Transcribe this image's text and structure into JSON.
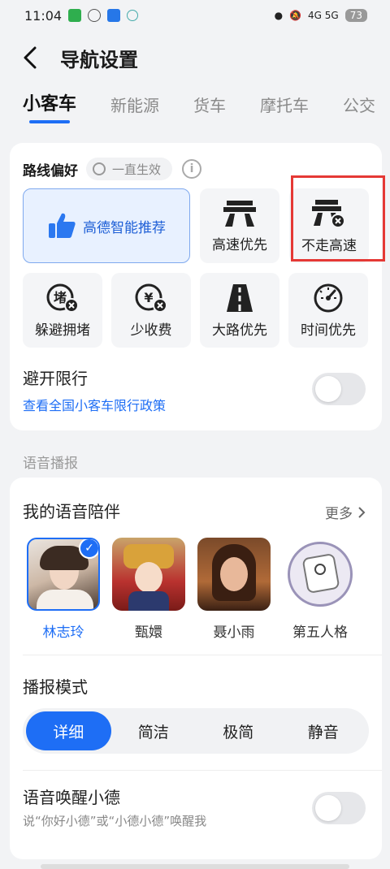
{
  "status": {
    "time": "11:04",
    "network": "4G 5G",
    "battery": "73"
  },
  "header": {
    "title": "导航设置"
  },
  "tabs": [
    {
      "label": "小客车"
    },
    {
      "label": "新能源"
    },
    {
      "label": "货车"
    },
    {
      "label": "摩托车"
    },
    {
      "label": "公交"
    }
  ],
  "route": {
    "title": "路线偏好",
    "always_label": "一直生效",
    "options": [
      {
        "label": "高德智能推荐",
        "icon": "thumbs-up-icon"
      },
      {
        "label": "高速优先",
        "icon": "highway-icon"
      },
      {
        "label": "不走高速",
        "icon": "no-highway-icon"
      },
      {
        "label": "躲避拥堵",
        "icon": "avoid-congestion-icon"
      },
      {
        "label": "少收费",
        "icon": "less-toll-icon"
      },
      {
        "label": "大路优先",
        "icon": "main-road-icon"
      },
      {
        "label": "时间优先",
        "icon": "speedometer-icon"
      }
    ],
    "restrict_title": "避开限行",
    "restrict_link": "查看全国小客车限行政策"
  },
  "voice": {
    "section_label": "语音播报",
    "companion_title": "我的语音陪伴",
    "more_label": "更多",
    "avatars": [
      {
        "name": "林志玲",
        "selected": true
      },
      {
        "name": "甄嬛",
        "selected": false
      },
      {
        "name": "聂小雨",
        "selected": false
      },
      {
        "name": "第五人格",
        "selected": false
      }
    ],
    "mode_title": "播报模式",
    "modes": [
      {
        "label": "详细",
        "active": true
      },
      {
        "label": "简洁",
        "active": false
      },
      {
        "label": "极简",
        "active": false
      },
      {
        "label": "静音",
        "active": false
      }
    ],
    "wake_title": "语音唤醒小德",
    "wake_sub": "说“你好小德”或“小德小德”唤醒我"
  },
  "colors": {
    "accent": "#1e6ef5",
    "highlight": "#e53935"
  }
}
